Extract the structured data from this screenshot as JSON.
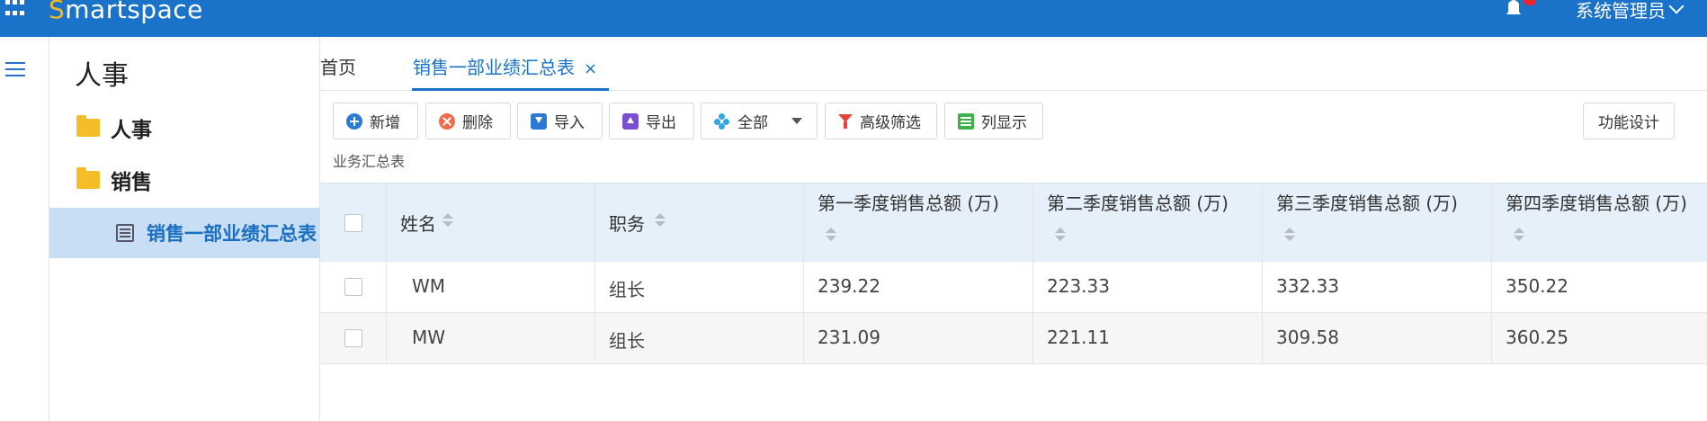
{
  "header": {
    "logo_first": "S",
    "logo_rest": "martspace",
    "user_menu": "系统管理员"
  },
  "sidebar": {
    "title": "人事",
    "items": [
      {
        "label": "人事",
        "icon": "folder-icon"
      },
      {
        "label": "销售",
        "icon": "folder-open-icon"
      },
      {
        "label": "销售一部业绩汇总表",
        "icon": "list-icon",
        "active": true
      }
    ]
  },
  "tabs": [
    {
      "label": "首页"
    },
    {
      "label": "销售一部业绩汇总表",
      "close": "×",
      "active": true
    }
  ],
  "toolbar": {
    "add": "新增",
    "delete": "删除",
    "import": "导入",
    "export": "导出",
    "scope": "全部",
    "advanced_filter": "高级筛选",
    "columns": "列显示",
    "design": "功能设计"
  },
  "table": {
    "caption": "业务汇总表",
    "columns": [
      "姓名",
      "职务",
      "第一季度销售总额 (万)",
      "第二季度销售总额 (万)",
      "第三季度销售总额 (万)",
      "第四季度销售总额 (万)"
    ],
    "rows": [
      [
        "WM",
        "组长",
        "239.22",
        "223.33",
        "332.33",
        "350.22"
      ],
      [
        "MW",
        "组长",
        "231.09",
        "221.11",
        "309.58",
        "360.25"
      ]
    ]
  },
  "colors": {
    "topbar": "#1a73c9",
    "accent": "#1a73c9",
    "active_sidebar": "#c7def4",
    "table_header": "#e6f0fb"
  }
}
